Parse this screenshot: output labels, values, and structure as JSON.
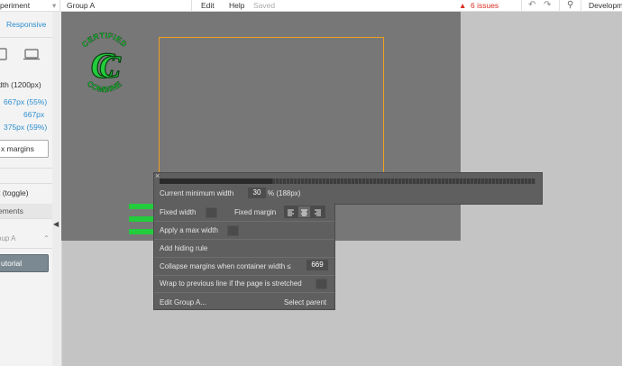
{
  "topbar": {
    "page_name": "periment",
    "element_name": "Group A",
    "edit_label": "Edit",
    "help_label": "Help",
    "saved_label": "Saved",
    "issues_label": "6 issues",
    "env_label": "Developm",
    "issues_color": "#d93025"
  },
  "sidebar": {
    "responsive_label": "Responsive",
    "width_label": "dth (1200px)",
    "val_1": "667px (55%)",
    "val_2": "667px",
    "val_3": "375px (59%)",
    "margins_button": "x margins",
    "toggle_label": "t (toggle)",
    "elements_header": "ements",
    "element_item": "oup A",
    "tutorial_button": "utorial"
  },
  "logo": {
    "top_text": "CERTIFIED",
    "bottom_text": "COMBINE",
    "monogram": "CC"
  },
  "width_panel": {
    "close_symbol": "×",
    "min_width_label": "Current minimum width",
    "min_width_value": "30",
    "min_width_suffix": "% (188px)"
  },
  "props_panel": {
    "fixed_width_label": "Fixed width",
    "fixed_margin_label": "Fixed margin",
    "max_width_label": "Apply a max width",
    "hiding_rule_label": "Add hiding rule",
    "collapse_label": "Collapse margins when container width ≤",
    "collapse_value": "669",
    "wrap_label": "Wrap to previous line if the page is stretched",
    "edit_label": "Edit Group A...",
    "select_parent_label": "Select parent"
  },
  "colors": {
    "accent_blue": "#2d8ecf",
    "outline_orange": "#f0a020",
    "green": "#22cc3c"
  }
}
